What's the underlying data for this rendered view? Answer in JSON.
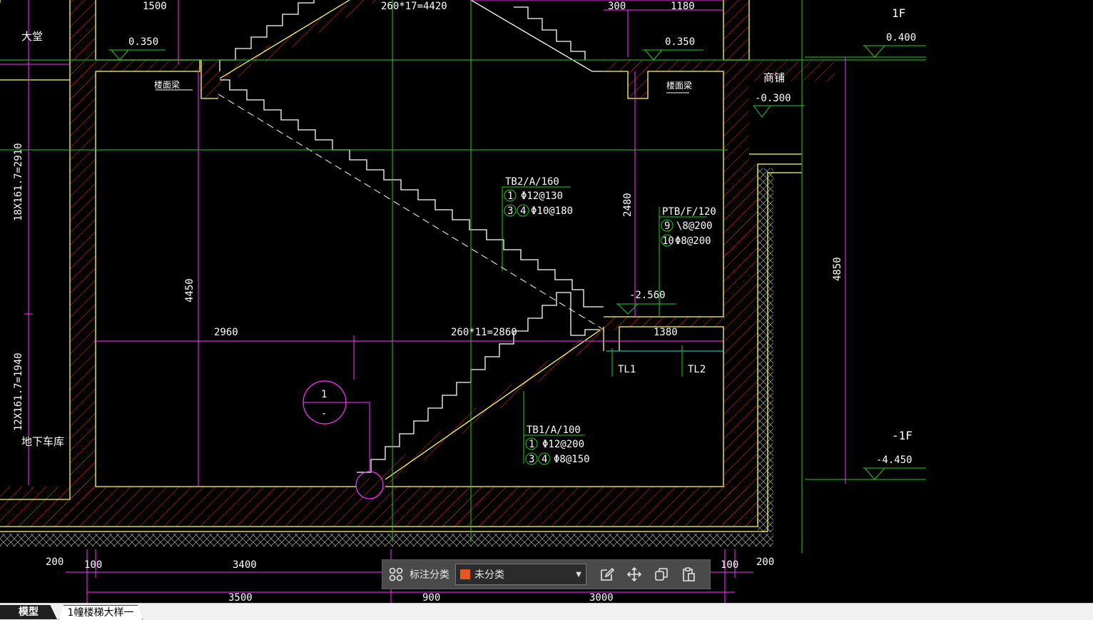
{
  "drawing": {
    "dims": {
      "d1500": "1500",
      "d_top_run": "260*17=4420",
      "d300": "300",
      "d1180": "1180",
      "d2960": "2960",
      "d_bottom_run": "260*11=2860",
      "d1380": "1380",
      "d_left_upper": "18X161.7=2910",
      "d_left_lower": "12X161.7=1940",
      "d4450": "4450",
      "d2480": "2480",
      "d4850": "4850",
      "d200_left": "200",
      "d100_left": "100",
      "d3400": "3400",
      "d100_right": "100",
      "d200_right": "200",
      "d3500": "3500",
      "d900": "900",
      "d3000": "3000"
    },
    "levels": {
      "lobby_left": "0.350",
      "lobby_right": "0.350",
      "f1_level": "0.400",
      "shop_level": "-0.300",
      "landing_level": "-2.560",
      "b1_level": "-4.450",
      "f1_label": "1F",
      "b1_label": "-1F"
    },
    "rooms": {
      "lobby": "大堂",
      "garage": "地下车库",
      "shop": "商铺",
      "slab_beam_left": "楼面梁",
      "slab_beam_right": "楼面梁"
    },
    "rebar": {
      "tb2_title": "TB2/A/160",
      "tb2_line1": "Φ12@130",
      "tb2_line2": "Φ10@180",
      "ptb_title": "PTB/F/120",
      "ptb_line1": "\\8@200",
      "ptb_line2": "Φ8@200",
      "tb1_title": "TB1/A/100",
      "tb1_line1": "Φ12@200",
      "tb1_line2": "Φ8@150",
      "tag1": "1",
      "tag3": "3",
      "tag4": "4",
      "tag9": "9",
      "tag10": "10"
    },
    "beams": {
      "tl1": "TL1",
      "tl2": "TL2"
    },
    "section_mark": {
      "top": "1",
      "bottom": "-"
    }
  },
  "toolbar": {
    "category_label": "标注分类",
    "category_value": "未分类",
    "category_color": "#e8561c"
  },
  "tabs": {
    "model": "模型",
    "layout": "1幢楼梯大样一"
  }
}
